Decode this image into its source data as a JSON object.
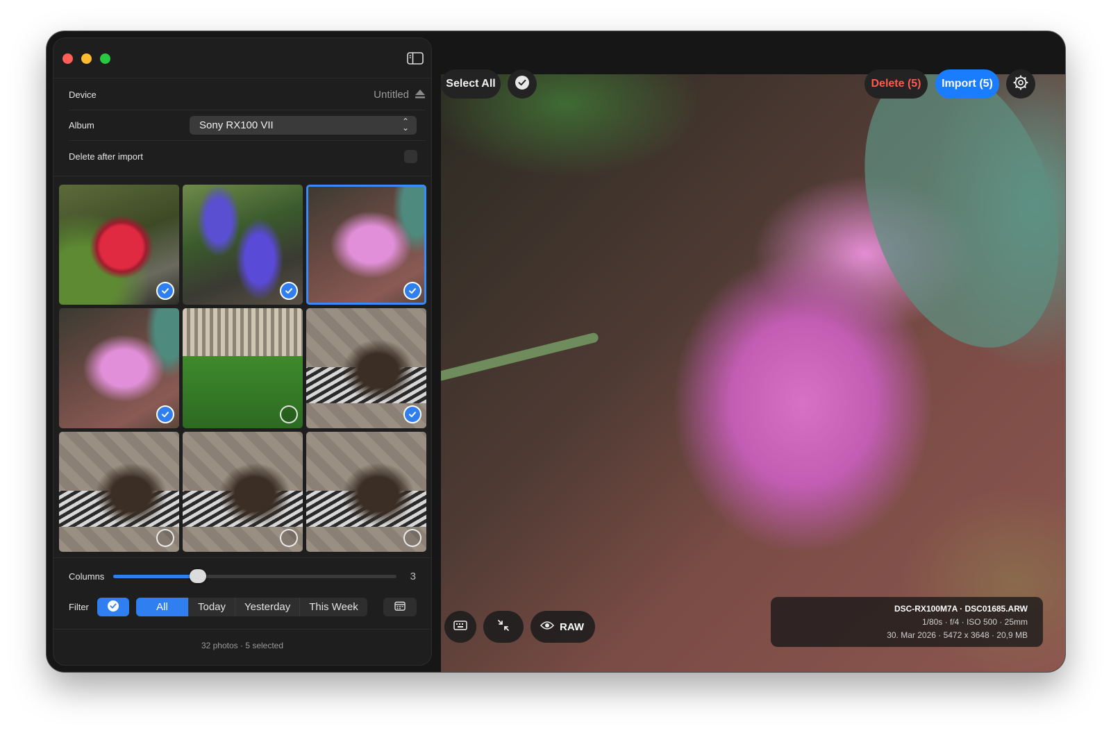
{
  "sidebar": {
    "device_label": "Device",
    "device_value": "Untitled",
    "album_label": "Album",
    "album_value": "Sony RX100 VII",
    "delete_after_import_label": "Delete after import",
    "columns_label": "Columns",
    "columns_value": "3",
    "columns_fraction": 0.3,
    "filter_label": "Filter",
    "filter_options": [
      "All",
      "Today",
      "Yesterday",
      "This Week"
    ],
    "filter_selected": "All",
    "footer": "32 photos · 5 selected"
  },
  "thumbnails": [
    {
      "subject": "red-daisy",
      "selected": true,
      "current": false
    },
    {
      "subject": "grape-hyacinth",
      "selected": true,
      "current": false
    },
    {
      "subject": "pink-hyacinth",
      "selected": true,
      "current": true
    },
    {
      "subject": "pink-hyacinth",
      "selected": true,
      "current": false
    },
    {
      "subject": "fence-grass",
      "selected": false,
      "current": false
    },
    {
      "subject": "dog-drain",
      "selected": true,
      "current": false
    },
    {
      "subject": "dog-drain",
      "selected": false,
      "current": false
    },
    {
      "subject": "dog-drain",
      "selected": false,
      "current": false
    },
    {
      "subject": "dog-drain",
      "selected": false,
      "current": false
    }
  ],
  "toolbar": {
    "select_all": "Select All",
    "delete": "Delete (5)",
    "import": "Import (5)"
  },
  "viewer": {
    "raw_label": "RAW",
    "info_line1": "DSC-RX100M7A  ·  DSC01685.ARW",
    "info_line2": "1/80s  ·  f/4  ·  ISO 500  ·  25mm",
    "info_line3": "30. Mar 2026  ·  5472 x 3648  ·  20,9 MB"
  },
  "colors": {
    "accent": "#2f7ff0",
    "danger": "#ff5a4e",
    "traffic_close": "#ff5f57",
    "traffic_min": "#febc2e",
    "traffic_max": "#28c840"
  }
}
